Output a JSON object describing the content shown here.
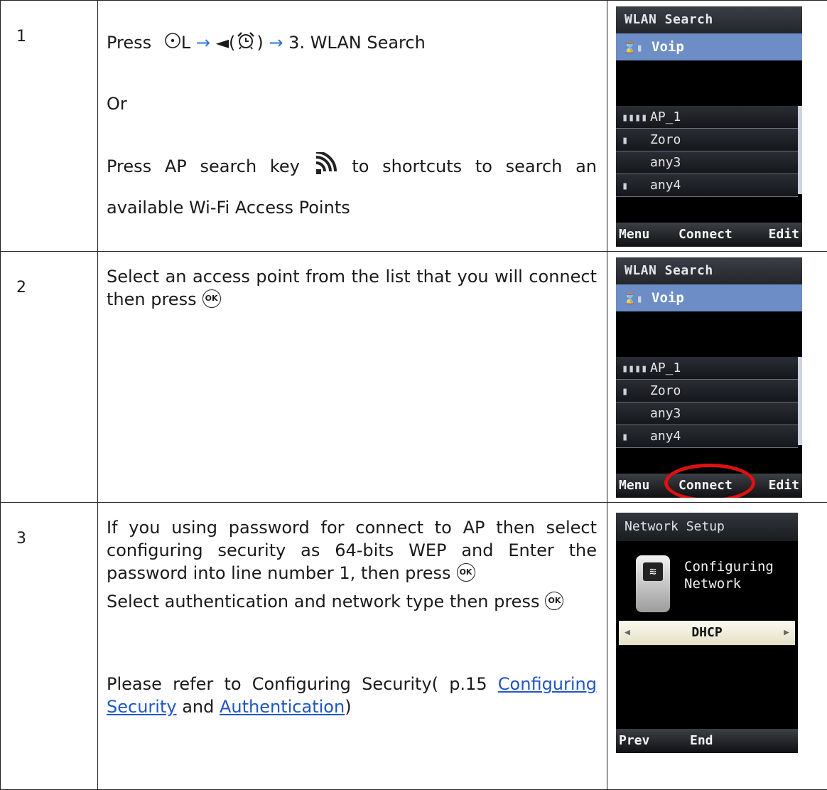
{
  "steps": [
    {
      "number": "1",
      "line1_press": "Press",
      "line1_L": "L",
      "line1_arrow1": "→",
      "line1_left": "◄(",
      "line1_close": ")",
      "line1_arrow2": "→",
      "line1_menu": "3. WLAN Search",
      "line2": "Or",
      "line3": "Press AP search key",
      "line3_tail": "to shortcuts to search an",
      "line4": "available Wi-Fi Access Points"
    },
    {
      "number": "2",
      "line1": "Select an access point from the list that you will connect",
      "line2": "then press"
    },
    {
      "number": "3",
      "para1a": "If you using password for connect to AP then select",
      "para1b": "configuring security as 64-bits WEP and Enter the",
      "para1c": "password into line number 1, then press",
      "para2": "Select authentication and network type then press",
      "para3a": "Please refer to Configuring Security( p.15",
      "link1a": "Configuring",
      "link1b": "Security",
      "para3and": "and",
      "link2": "Authentication",
      "para3end": ")"
    }
  ],
  "ok_icon": "OK",
  "wlan_screen": {
    "title": "WLAN Search",
    "selected": "Voip",
    "aps": [
      {
        "signal": "▮▮▮▮",
        "name": "AP_1"
      },
      {
        "signal": "▮",
        "name": "Zoro"
      },
      {
        "signal": "",
        "name": "any3"
      },
      {
        "signal": "▮",
        "name": "any4"
      }
    ],
    "softkeys": {
      "left": "Menu",
      "center": "Connect",
      "right": "Edit"
    }
  },
  "wlan_screen2": {
    "aps": [
      {
        "signal": "▮▮▮▮",
        "name": "AP_1"
      },
      {
        "signal": "▮",
        "name": "Zoro"
      },
      {
        "signal": "",
        "name": "any3"
      },
      {
        "signal": "▮",
        "name": "any4"
      }
    ]
  },
  "network_screen": {
    "title": "Network Setup",
    "config_line1": "Configuring",
    "config_line2": "Network",
    "mode": "DHCP",
    "softkeys": {
      "left": "Prev",
      "center": "End"
    }
  },
  "colors": {
    "highlight_ring": "#e01010",
    "selected_row": "#6c8dc6",
    "link": "#1f56c4"
  },
  "icons": [
    "nav-key-icon",
    "alarm-clock-icon",
    "ap-search-key-icon",
    "ok-key-icon",
    "signal-icon",
    "wifi-icon"
  ]
}
